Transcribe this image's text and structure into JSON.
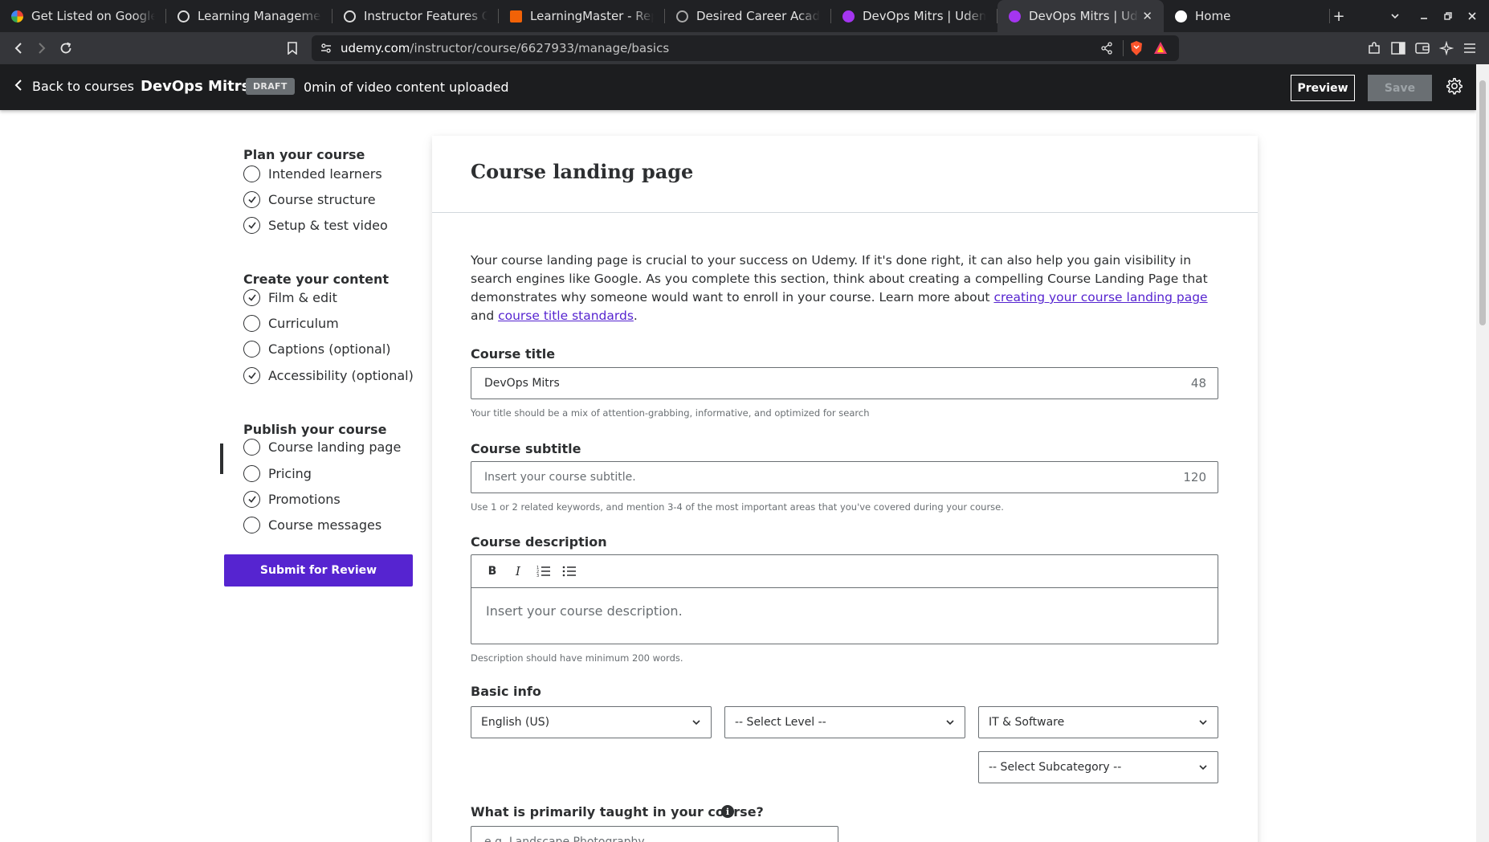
{
  "browser": {
    "tabs": [
      {
        "title": "Get Listed on Google - G",
        "icon": "google-icon",
        "color": "#ffffff"
      },
      {
        "title": "Learning Management Sy",
        "icon": "openai-icon",
        "color": "#ffffff"
      },
      {
        "title": "Instructor Features Com",
        "icon": "openai-icon",
        "color": "#ffffff"
      },
      {
        "title": "LearningMaster - Replit",
        "icon": "replit-icon",
        "color": "#f26207"
      },
      {
        "title": "Desired Career Academy",
        "icon": "globe-icon",
        "color": "#9aa0a6"
      },
      {
        "title": "DevOps Mitrs | Udemy",
        "icon": "udemy-icon",
        "color": "#a435f0"
      },
      {
        "title": "DevOps Mitrs | Udemy",
        "icon": "udemy-icon",
        "color": "#a435f0",
        "active": true
      },
      {
        "title": "Home",
        "icon": "udemy-icon",
        "color": "#ffffff"
      }
    ],
    "url_host": "udemy.com",
    "url_path": "/instructor/course/6627933/manage/basics"
  },
  "header": {
    "back_label": "Back to courses",
    "course_name": "DevOps Mitrs",
    "status_badge": "DRAFT",
    "upload_status": "0min of video content uploaded",
    "preview_label": "Preview",
    "save_label": "Save"
  },
  "sidebar": {
    "sections": [
      {
        "title": "Plan your course",
        "items": [
          {
            "label": "Intended learners",
            "done": false
          },
          {
            "label": "Course structure",
            "done": true
          },
          {
            "label": "Setup & test video",
            "done": true
          }
        ]
      },
      {
        "title": "Create your content",
        "items": [
          {
            "label": "Film & edit",
            "done": true
          },
          {
            "label": "Curriculum",
            "done": false
          },
          {
            "label": "Captions (optional)",
            "done": false
          },
          {
            "label": "Accessibility (optional)",
            "done": true
          }
        ]
      },
      {
        "title": "Publish your course",
        "items": [
          {
            "label": "Course landing page",
            "done": false,
            "active": true
          },
          {
            "label": "Pricing",
            "done": false
          },
          {
            "label": "Promotions",
            "done": true
          },
          {
            "label": "Course messages",
            "done": false
          }
        ]
      }
    ],
    "submit_label": "Submit for Review"
  },
  "main": {
    "title": "Course landing page",
    "intro_text": "Your course landing page is crucial to your success on Udemy. If it's done right, it can also help you gain visibility in search engines like Google. As you complete this section, think about creating a compelling Course Landing Page that demonstrates why someone would want to enroll in your course. Learn more about ",
    "intro_link1": "creating your course landing page",
    "intro_and": " and ",
    "intro_link2": "course title standards",
    "intro_end": ".",
    "course_title": {
      "label": "Course title",
      "value": "DevOps Mitrs",
      "counter": "48",
      "hint": "Your title should be a mix of attention-grabbing, informative, and optimized for search"
    },
    "course_subtitle": {
      "label": "Course subtitle",
      "placeholder": "Insert your course subtitle.",
      "counter": "120",
      "hint": "Use 1 or 2 related keywords, and mention 3-4 of the most important areas that you've covered during your course."
    },
    "course_description": {
      "label": "Course description",
      "placeholder": "Insert your course description.",
      "hint": "Description should have minimum 200 words.",
      "toolbar": [
        "B",
        "I",
        "ordered-list",
        "bulleted-list"
      ]
    },
    "basic_info": {
      "label": "Basic info",
      "language": "English (US)",
      "level": "-- Select Level --",
      "category": "IT & Software",
      "subcategory": "-- Select Subcategory --"
    },
    "primarily_taught": {
      "label": "What is primarily taught in your course?",
      "placeholder": "e.g. Landscape Photography"
    }
  }
}
